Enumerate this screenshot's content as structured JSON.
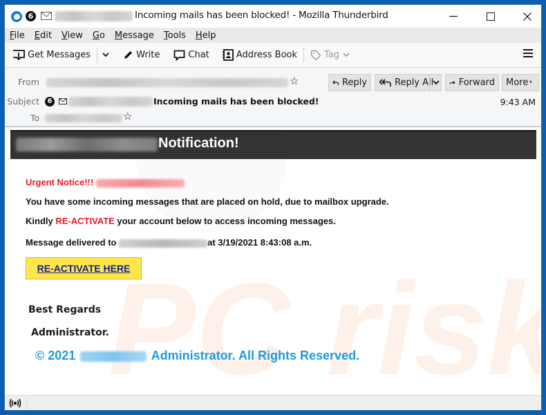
{
  "window": {
    "unread_badge": "6",
    "title": "Incoming mails has been blocked! - Mozilla Thunderbird",
    "controls": {
      "minimize": "—",
      "maximize": "☐",
      "close": "✕"
    }
  },
  "menubar": {
    "items": [
      {
        "accel": "F",
        "rest": "ile"
      },
      {
        "accel": "E",
        "rest": "dit"
      },
      {
        "accel": "V",
        "rest": "iew"
      },
      {
        "accel": "G",
        "rest": "o"
      },
      {
        "accel": "M",
        "rest": "essage"
      },
      {
        "accel": "T",
        "rest": "ools"
      },
      {
        "accel": "H",
        "rest": "elp"
      }
    ]
  },
  "toolbar": {
    "get_messages": "Get Messages",
    "write": "Write",
    "chat": "Chat",
    "address_book": "Address Book",
    "tag": "Tag"
  },
  "header": {
    "from_label": "From",
    "subject_label": "Subject",
    "to_label": "To",
    "subject_badge": "6",
    "subject_text": "Incoming mails has been blocked!",
    "time": "9:43 AM",
    "buttons": {
      "reply": "Reply",
      "reply_all": "Reply All",
      "forward": "Forward",
      "more": "More"
    }
  },
  "email": {
    "banner_title": "Notification!",
    "urgent": "Urgent Notice!!!",
    "line1": "You have some incoming messages that are placed on hold, due to mailbox upgrade.",
    "line2_pre": "Kindly ",
    "line2_red": "RE-ACTIVATE",
    "line2_post": " your account below to access incoming messages.",
    "line3_pre": "Message delivered to ",
    "line3_post": "at 3/19/2021 8:43:08 a.m.",
    "cta": "RE-ACTIVATE HERE",
    "regards": "Best Regards",
    "signature": "Administrator.",
    "copyright_pre": "© 2021",
    "copyright_post": "Administrator. All Rights Reserved.",
    "colors": {
      "urgent_red": "#ee1c25",
      "cta_bg": "#fde84b",
      "cta_link": "#1a1a8c",
      "copyright_blue": "#1d9ae0",
      "banner_bg": "#333333"
    }
  },
  "watermark": {
    "text": "PC risk.com"
  }
}
